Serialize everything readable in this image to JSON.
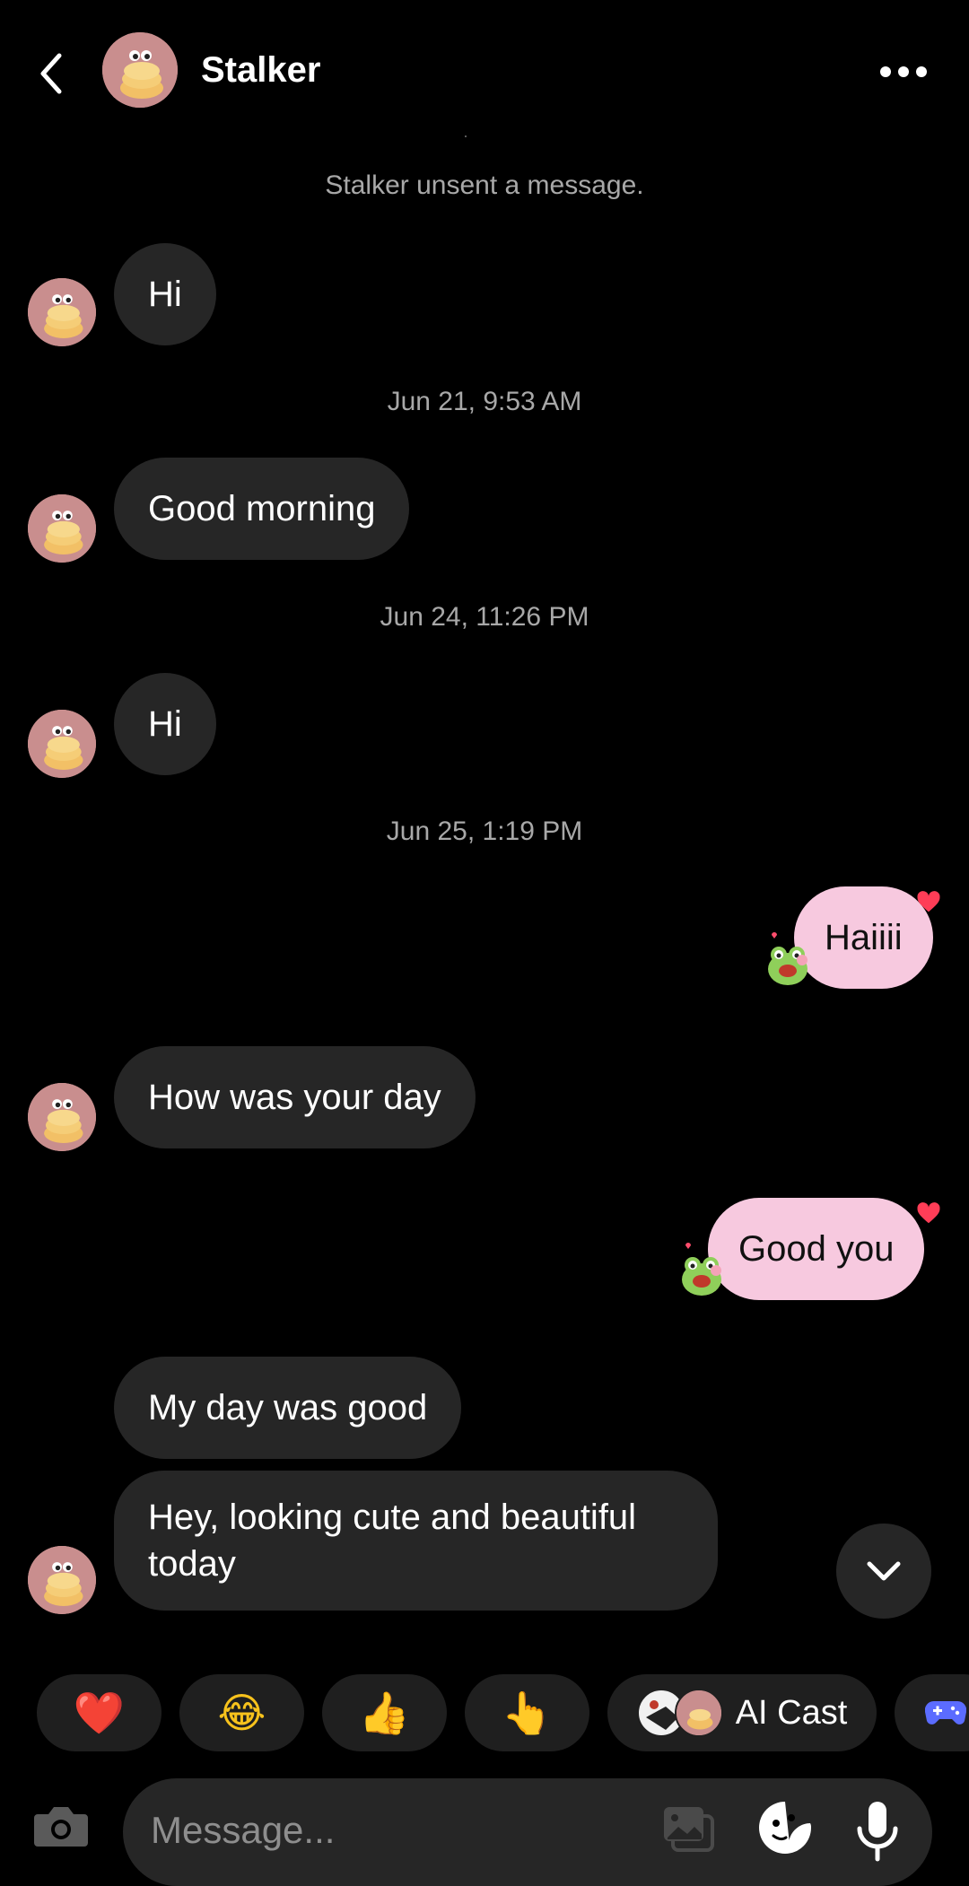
{
  "header": {
    "contact_name": "Stalker",
    "back_icon": "chevron-left-icon",
    "more_icon": "more-horizontal-icon"
  },
  "conversation": {
    "unsent_notice": "Stalker unsent a message.",
    "messages": [
      {
        "side": "in",
        "text": "Hi"
      },
      {
        "timestamp": "Jun 21, 9:53 AM"
      },
      {
        "side": "in",
        "text": "Good morning"
      },
      {
        "timestamp": "Jun 24, 11:26 PM"
      },
      {
        "side": "in",
        "text": "Hi"
      },
      {
        "timestamp": "Jun 25, 1:19 PM"
      },
      {
        "side": "out",
        "text": "Haiiii",
        "reaction": "heart"
      },
      {
        "side": "in",
        "text": "How was your day"
      },
      {
        "side": "out",
        "text": "Good you",
        "reaction": "heart"
      },
      {
        "side": "in",
        "text": "My day was good"
      },
      {
        "side": "in",
        "text": "Hey, looking cute and beautiful today"
      }
    ]
  },
  "quick_reactions": [
    {
      "emoji": "❤️",
      "name": "red-heart"
    },
    {
      "emoji": "😂",
      "name": "tears-of-joy"
    },
    {
      "emoji": "👍",
      "name": "thumbs-up"
    },
    {
      "emoji": "👆",
      "name": "pointing-up"
    }
  ],
  "ai_cast": {
    "label": "AI Cast"
  },
  "composer": {
    "placeholder": "Message..."
  },
  "colors": {
    "background": "#000000",
    "incoming_bubble": "#262626",
    "outgoing_bubble": "#f7c9df",
    "reaction_heart": "#ff3d57",
    "game_accent": "#5b6cff"
  }
}
